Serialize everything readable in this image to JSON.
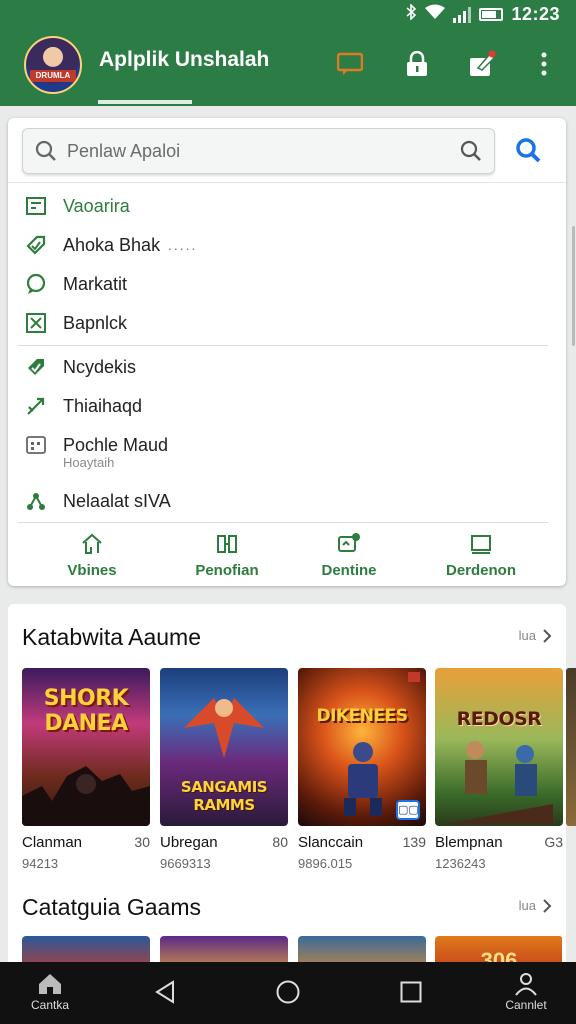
{
  "status_bar": {
    "time": "12:23"
  },
  "header": {
    "avatar_text": "DRUMLA",
    "title": "Aplplik Unshalah",
    "icons": [
      "chat-icon",
      "lock-icon",
      "edit-icon",
      "more-icon"
    ]
  },
  "search": {
    "placeholder": "Penlaw Apaloi"
  },
  "menu": {
    "items": [
      {
        "label": "Vaoarira",
        "icon": "list-icon",
        "green": true
      },
      {
        "label": "Ahoka Bhak",
        "icon": "tag-icon",
        "extra": "....."
      },
      {
        "label": "Markatit",
        "icon": "chat-bubble-icon"
      },
      {
        "label": "Bapnlck",
        "icon": "grid-icon"
      },
      {
        "label": "Ncydekis",
        "icon": "tag-icon"
      },
      {
        "label": "Thiaihaqd",
        "icon": "rocket-icon"
      },
      {
        "label": "Pochle Maud",
        "icon": "calendar-icon",
        "sub": "Hoaytaih"
      },
      {
        "label": "Nelaalat sIVA",
        "icon": "share-icon"
      }
    ],
    "tabs": [
      {
        "label": "Vbines",
        "icon": "home-icon"
      },
      {
        "label": "Penofian",
        "icon": "book-icon"
      },
      {
        "label": "Dentine",
        "icon": "message-icon"
      },
      {
        "label": "Derdenon",
        "icon": "square-icon"
      }
    ]
  },
  "sections": [
    {
      "title": "Katabwita Aaume",
      "more": "lua",
      "games": [
        {
          "art_title": "SHORK DANEA",
          "name": "Clanman",
          "score": "30",
          "count": "94213"
        },
        {
          "art_title": "SANGAMIS RAMMS",
          "name": "Ubregan",
          "score": "80",
          "count": "9669313"
        },
        {
          "art_title": "DIKENEES",
          "name": "Slanccain",
          "score": "139",
          "count": "9896.015"
        },
        {
          "art_title": "REDOSR",
          "name": "Blempnan",
          "score": "G3",
          "count": "1236243"
        }
      ]
    },
    {
      "title": "Catatguia Gaams",
      "more": "lua",
      "games": [
        {
          "art_title": ""
        },
        {
          "art_title": ""
        },
        {
          "art_title": ""
        },
        {
          "art_title": "306"
        }
      ]
    }
  ],
  "nav": {
    "home_label": "Cantka",
    "profile_label": "Cannlet"
  },
  "colors": {
    "primary_green": "#2c7d45",
    "accent_blue": "#1a73e8",
    "accent_orange": "#e07b22"
  }
}
